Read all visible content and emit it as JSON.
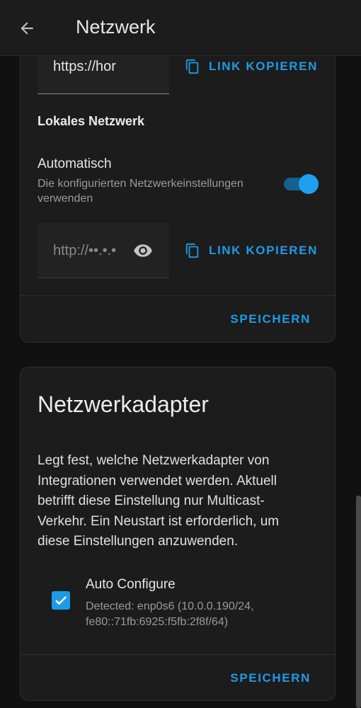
{
  "appbar": {
    "title": "Netzwerk",
    "back_icon": "arrow-left-icon"
  },
  "external_url": {
    "value": "https://hor",
    "copy_label": "LINK KOPIEREN"
  },
  "local_network": {
    "section_title": "Lokales Netzwerk",
    "auto_label": "Automatisch",
    "auto_description": "Die konfigurierten Netzwerkeinstellungen verwenden",
    "auto_enabled": true,
    "url_value": "http://••.•.•",
    "copy_label": "LINK KOPIEREN",
    "save_label": "SPEICHERN"
  },
  "network_adapter": {
    "heading": "Netzwerkadapter",
    "description": "Legt fest, welche Netzwerkadapter von Integrationen verwendet werden. Aktuell betrifft diese Einstellung nur Multicast-Verkehr. Ein Neustart ist erforderlich, um diese Einstellungen anzuwenden.",
    "auto_configure": {
      "label": "Auto Configure",
      "detail": "Detected: enp0s6 (10.0.0.190/24, fe80::71fb:6925:f5fb:2f8f/64)",
      "checked": true
    },
    "save_label": "SPEICHERN"
  },
  "colors": {
    "accent": "#1e9be8",
    "background": "#111111",
    "card": "#1c1c1c"
  }
}
